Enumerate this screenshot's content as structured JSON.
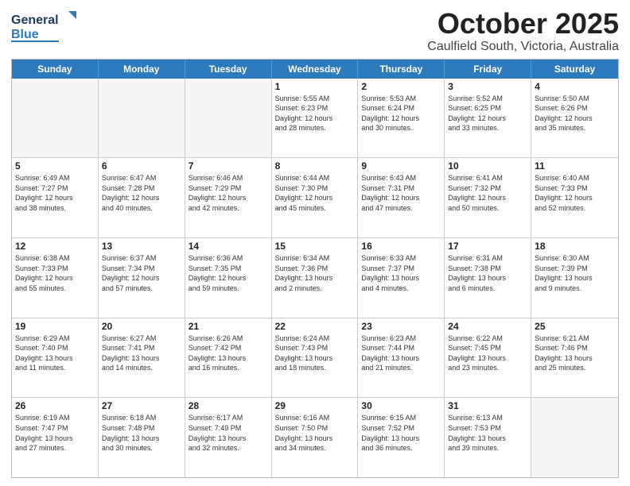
{
  "header": {
    "logo_general": "General",
    "logo_blue": "Blue",
    "month": "October 2025",
    "location": "Caulfield South, Victoria, Australia"
  },
  "weekdays": [
    "Sunday",
    "Monday",
    "Tuesday",
    "Wednesday",
    "Thursday",
    "Friday",
    "Saturday"
  ],
  "rows": [
    [
      {
        "day": "",
        "info": ""
      },
      {
        "day": "",
        "info": ""
      },
      {
        "day": "",
        "info": ""
      },
      {
        "day": "1",
        "info": "Sunrise: 5:55 AM\nSunset: 6:23 PM\nDaylight: 12 hours\nand 28 minutes."
      },
      {
        "day": "2",
        "info": "Sunrise: 5:53 AM\nSunset: 6:24 PM\nDaylight: 12 hours\nand 30 minutes."
      },
      {
        "day": "3",
        "info": "Sunrise: 5:52 AM\nSunset: 6:25 PM\nDaylight: 12 hours\nand 33 minutes."
      },
      {
        "day": "4",
        "info": "Sunrise: 5:50 AM\nSunset: 6:26 PM\nDaylight: 12 hours\nand 35 minutes."
      }
    ],
    [
      {
        "day": "5",
        "info": "Sunrise: 6:49 AM\nSunset: 7:27 PM\nDaylight: 12 hours\nand 38 minutes."
      },
      {
        "day": "6",
        "info": "Sunrise: 6:47 AM\nSunset: 7:28 PM\nDaylight: 12 hours\nand 40 minutes."
      },
      {
        "day": "7",
        "info": "Sunrise: 6:46 AM\nSunset: 7:29 PM\nDaylight: 12 hours\nand 42 minutes."
      },
      {
        "day": "8",
        "info": "Sunrise: 6:44 AM\nSunset: 7:30 PM\nDaylight: 12 hours\nand 45 minutes."
      },
      {
        "day": "9",
        "info": "Sunrise: 6:43 AM\nSunset: 7:31 PM\nDaylight: 12 hours\nand 47 minutes."
      },
      {
        "day": "10",
        "info": "Sunrise: 6:41 AM\nSunset: 7:32 PM\nDaylight: 12 hours\nand 50 minutes."
      },
      {
        "day": "11",
        "info": "Sunrise: 6:40 AM\nSunset: 7:33 PM\nDaylight: 12 hours\nand 52 minutes."
      }
    ],
    [
      {
        "day": "12",
        "info": "Sunrise: 6:38 AM\nSunset: 7:33 PM\nDaylight: 12 hours\nand 55 minutes."
      },
      {
        "day": "13",
        "info": "Sunrise: 6:37 AM\nSunset: 7:34 PM\nDaylight: 12 hours\nand 57 minutes."
      },
      {
        "day": "14",
        "info": "Sunrise: 6:36 AM\nSunset: 7:35 PM\nDaylight: 12 hours\nand 59 minutes."
      },
      {
        "day": "15",
        "info": "Sunrise: 6:34 AM\nSunset: 7:36 PM\nDaylight: 13 hours\nand 2 minutes."
      },
      {
        "day": "16",
        "info": "Sunrise: 6:33 AM\nSunset: 7:37 PM\nDaylight: 13 hours\nand 4 minutes."
      },
      {
        "day": "17",
        "info": "Sunrise: 6:31 AM\nSunset: 7:38 PM\nDaylight: 13 hours\nand 6 minutes."
      },
      {
        "day": "18",
        "info": "Sunrise: 6:30 AM\nSunset: 7:39 PM\nDaylight: 13 hours\nand 9 minutes."
      }
    ],
    [
      {
        "day": "19",
        "info": "Sunrise: 6:29 AM\nSunset: 7:40 PM\nDaylight: 13 hours\nand 11 minutes."
      },
      {
        "day": "20",
        "info": "Sunrise: 6:27 AM\nSunset: 7:41 PM\nDaylight: 13 hours\nand 14 minutes."
      },
      {
        "day": "21",
        "info": "Sunrise: 6:26 AM\nSunset: 7:42 PM\nDaylight: 13 hours\nand 16 minutes."
      },
      {
        "day": "22",
        "info": "Sunrise: 6:24 AM\nSunset: 7:43 PM\nDaylight: 13 hours\nand 18 minutes."
      },
      {
        "day": "23",
        "info": "Sunrise: 6:23 AM\nSunset: 7:44 PM\nDaylight: 13 hours\nand 21 minutes."
      },
      {
        "day": "24",
        "info": "Sunrise: 6:22 AM\nSunset: 7:45 PM\nDaylight: 13 hours\nand 23 minutes."
      },
      {
        "day": "25",
        "info": "Sunrise: 6:21 AM\nSunset: 7:46 PM\nDaylight: 13 hours\nand 25 minutes."
      }
    ],
    [
      {
        "day": "26",
        "info": "Sunrise: 6:19 AM\nSunset: 7:47 PM\nDaylight: 13 hours\nand 27 minutes."
      },
      {
        "day": "27",
        "info": "Sunrise: 6:18 AM\nSunset: 7:48 PM\nDaylight: 13 hours\nand 30 minutes."
      },
      {
        "day": "28",
        "info": "Sunrise: 6:17 AM\nSunset: 7:49 PM\nDaylight: 13 hours\nand 32 minutes."
      },
      {
        "day": "29",
        "info": "Sunrise: 6:16 AM\nSunset: 7:50 PM\nDaylight: 13 hours\nand 34 minutes."
      },
      {
        "day": "30",
        "info": "Sunrise: 6:15 AM\nSunset: 7:52 PM\nDaylight: 13 hours\nand 36 minutes."
      },
      {
        "day": "31",
        "info": "Sunrise: 6:13 AM\nSunset: 7:53 PM\nDaylight: 13 hours\nand 39 minutes."
      },
      {
        "day": "",
        "info": ""
      }
    ]
  ]
}
